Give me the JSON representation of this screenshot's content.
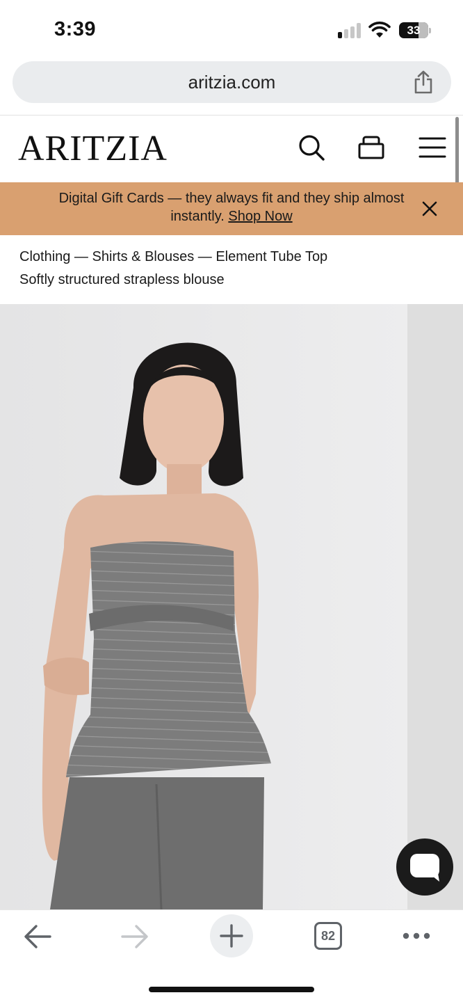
{
  "status_bar": {
    "time": "3:39",
    "battery_level": "33",
    "signal_bars": 1
  },
  "browser": {
    "url": "aritzia.com",
    "tab_count": "82"
  },
  "site": {
    "logo": "ARITZIA"
  },
  "promo": {
    "text": "Digital Gift Cards — they always fit and they ship almost instantly.",
    "link": "Shop Now"
  },
  "product": {
    "breadcrumb": "Clothing — Shirts & Blouses — Element Tube Top",
    "description": "Softly structured strapless blouse"
  },
  "icons": [
    "search-icon",
    "bag-icon",
    "menu-icon",
    "close-icon",
    "share-icon",
    "chat-icon",
    "back-icon",
    "forward-icon",
    "plus-icon",
    "more-icon"
  ]
}
